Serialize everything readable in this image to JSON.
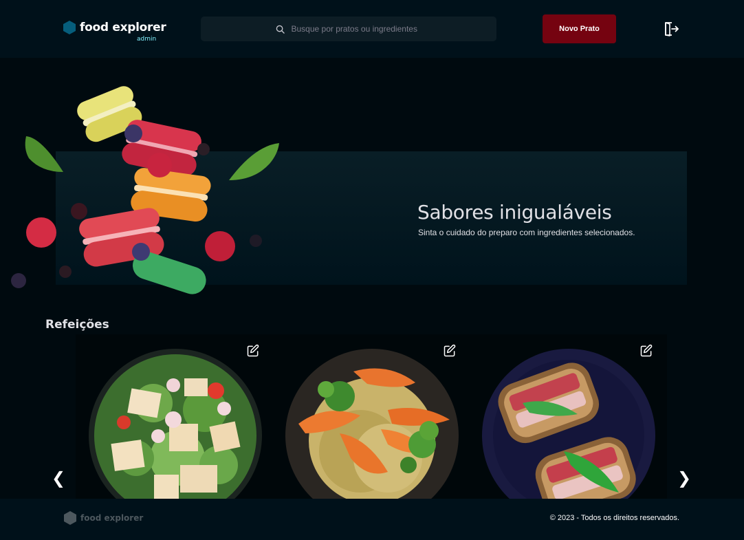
{
  "header": {
    "logo_name": "food explorer",
    "logo_sub": "admin",
    "search_placeholder": "Busque por pratos ou ingredientes",
    "new_dish_label": "Novo Prato",
    "icons": {
      "brand": "hexagon-icon",
      "search": "search-icon",
      "logout": "sign-out-icon"
    }
  },
  "banner": {
    "title": "Sabores inigualáveis",
    "subtitle": "Sinta o cuidado do preparo com ingredientes selecionados.",
    "image": "macarons-image"
  },
  "section": {
    "title": "Refeições",
    "dishes": [
      {
        "image": "salad-bowl-image",
        "edit_icon": "pencil-icon"
      },
      {
        "image": "shrimp-pasta-image",
        "edit_icon": "pencil-icon"
      },
      {
        "image": "bacon-toast-image",
        "edit_icon": "pencil-icon"
      }
    ],
    "prev_label": "❮",
    "next_label": "❯"
  },
  "footer": {
    "logo_name": "food explorer",
    "copyright": "© 2023 - Todos os direitos reservados."
  },
  "colors": {
    "background": "#000A0F",
    "header_bg": "#00111A",
    "accent_red": "#750310",
    "admin_cyan": "#82F3FF",
    "brand_blue": "#065E7C"
  }
}
